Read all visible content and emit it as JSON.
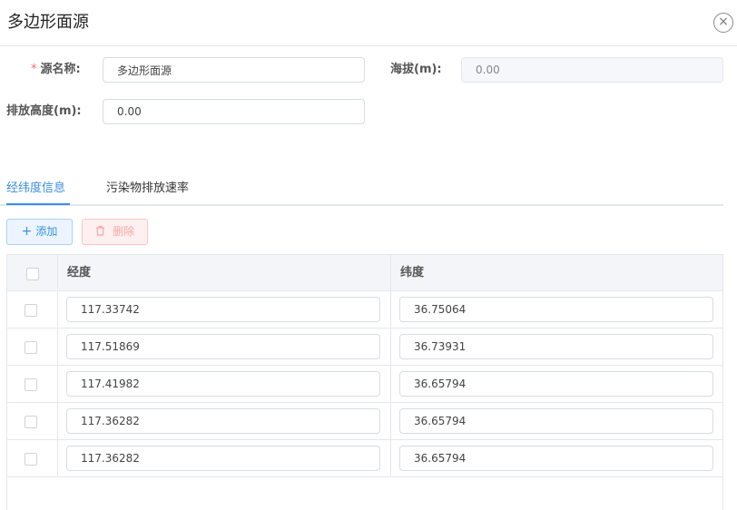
{
  "dialog": {
    "title": "多边形面源",
    "close_glyph": "×"
  },
  "form": {
    "required_mark": "*",
    "source_name_label": "源名称:",
    "source_name_value": "多边形面源",
    "altitude_label": "海拔(m):",
    "altitude_value": "0.00",
    "emission_height_label": "排放高度(m):",
    "emission_height_value": "0.00"
  },
  "tabs": [
    {
      "label": "经纬度信息",
      "active": true
    },
    {
      "label": "污染物排放速率",
      "active": false
    }
  ],
  "toolbar": {
    "add_icon": "plus-icon",
    "add_label": "添加",
    "delete_icon": "trash-icon",
    "delete_label": "删除"
  },
  "table": {
    "columns": [
      "经度",
      "纬度"
    ],
    "rows": [
      {
        "lng": "117.33742",
        "lat": "36.75064"
      },
      {
        "lng": "117.51869",
        "lat": "36.73931"
      },
      {
        "lng": "117.41982",
        "lat": "36.65794"
      },
      {
        "lng": "117.36282",
        "lat": "36.65794"
      },
      {
        "lng": "117.36282",
        "lat": "36.65794"
      }
    ]
  },
  "colors": {
    "accent": "#3a8ee6",
    "required": "#f56c6c",
    "danger_text": "#f8a6a6"
  }
}
